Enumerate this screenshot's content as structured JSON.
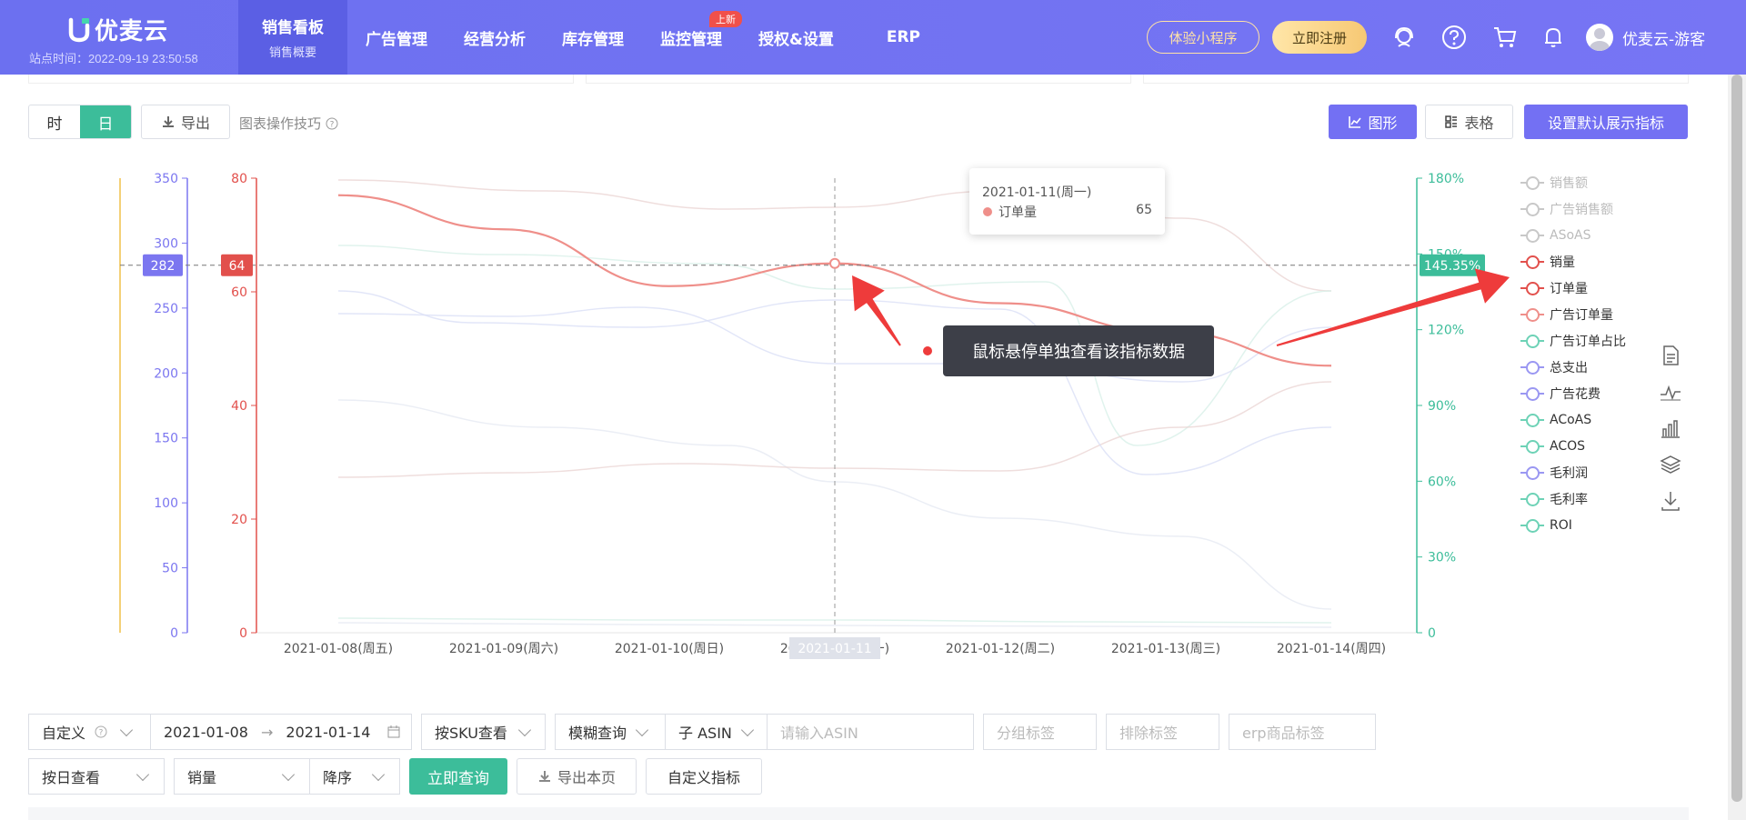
{
  "header": {
    "logo_text": "优麦云",
    "site_time": "站点时间：2022-09-19 23:50:58",
    "nav": [
      {
        "label": "销售看板",
        "sub": "销售概要",
        "active": true
      },
      {
        "label": "广告管理"
      },
      {
        "label": "经营分析"
      },
      {
        "label": "库存管理"
      },
      {
        "label": "监控管理",
        "badge": "上新"
      },
      {
        "label": "授权&设置"
      },
      {
        "label": "ERP"
      }
    ],
    "mini_program_label": "体验小程序",
    "register_label": "立即注册",
    "user_name": "优麦云-游客"
  },
  "toolbar": {
    "hour_label": "时",
    "day_label": "日",
    "export_label": "导出",
    "tips_label": "图表操作技巧",
    "chart_view_label": "图形",
    "table_view_label": "表格",
    "set_default_label": "设置默认展示指标"
  },
  "chart_data": {
    "type": "line",
    "categories": [
      "2021-01-08(周五)",
      "2021-01-09(周六)",
      "2021-01-10(周日)",
      "2021-01-11(周一)",
      "2021-01-12(周二)",
      "2021-01-13(周三)",
      "2021-01-14(周四)"
    ],
    "hover_category_label": "2021-01-11",
    "axes": {
      "left_outer": {
        "color": "#7b76f0",
        "min": 0,
        "max": 350,
        "ticks": [
          "0",
          "50",
          "100",
          "150",
          "200",
          "250",
          "300",
          "350"
        ],
        "crosshair_badge": "282"
      },
      "left_inner": {
        "color": "#e2504c",
        "min": 0,
        "max": 80,
        "ticks": [
          "0",
          "20",
          "40",
          "60",
          "80"
        ],
        "crosshair_badge": "64"
      },
      "right": {
        "color": "#3cbd9a",
        "min": 0,
        "max": 180,
        "ticks": [
          "0",
          "30%",
          "60%",
          "90%",
          "120%",
          "150%",
          "180%"
        ],
        "crosshair_badge": "145.35%"
      }
    },
    "series": [
      {
        "name": "订单量",
        "axis": "left_inner",
        "color": "#ef8f8a",
        "values": [
          77,
          71,
          61,
          65,
          58,
          53,
          47
        ],
        "highlighted": true
      }
    ],
    "faded_series_colors": [
      "#e9d3d1",
      "#d8def5",
      "#d6efe7",
      "#e4e8f2"
    ],
    "tooltip": {
      "date": "2021-01-11(周一)",
      "series": "订单量",
      "value": "65"
    },
    "legend": [
      {
        "label": "销售额",
        "color": "#c8c8c8",
        "active": false
      },
      {
        "label": "广告销售额",
        "color": "#c8c8c8",
        "active": false
      },
      {
        "label": "ASoAS",
        "color": "#c8c8c8",
        "active": false
      },
      {
        "label": "销量",
        "color": "#e2504c",
        "active": true
      },
      {
        "label": "订单量",
        "color": "#e2504c",
        "active": true
      },
      {
        "label": "广告订单量",
        "color": "#ef8f8a",
        "active": true
      },
      {
        "label": "广告订单占比",
        "color": "#6dd2b6",
        "active": true
      },
      {
        "label": "总支出",
        "color": "#9a97f2",
        "active": true
      },
      {
        "label": "广告花费",
        "color": "#9a97f2",
        "active": true
      },
      {
        "label": "ACoAS",
        "color": "#6dd2b6",
        "active": true
      },
      {
        "label": "ACOS",
        "color": "#6dd2b6",
        "active": true
      },
      {
        "label": "毛利润",
        "color": "#9a97f2",
        "active": true
      },
      {
        "label": "毛利率",
        "color": "#6dd2b6",
        "active": true
      },
      {
        "label": "ROI",
        "color": "#6dd2b6",
        "active": true
      }
    ]
  },
  "annotation": {
    "text": "鼠标悬停单独查看该指标数据"
  },
  "filters": {
    "date_mode": "自定义",
    "date_start": "2021-01-08",
    "date_end": "2021-01-14",
    "view_by": "按SKU查看",
    "query_mode": "模糊查询",
    "asin_type": "子 ASIN",
    "asin_placeholder": "请输入ASIN",
    "group_tag_placeholder": "分组标签",
    "exclude_tag_placeholder": "排除标签",
    "erp_tag_placeholder": "erp商品标签",
    "period": "按日查看",
    "sort_field": "销量",
    "sort_order": "降序",
    "query_label": "立即查询",
    "export_page_label": "导出本页",
    "custom_metrics_label": "自定义指标"
  },
  "colors": {
    "brand": "#7370f3",
    "accent_green": "#3cbd9a",
    "order_line": "#ef8f8a"
  }
}
